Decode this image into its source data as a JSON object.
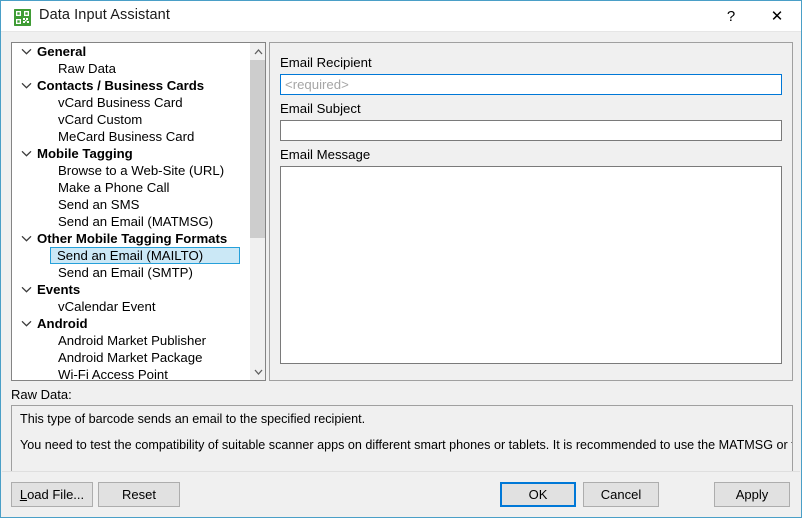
{
  "window": {
    "title": "Data Input Assistant",
    "icon": "qr-code-icon",
    "accent_color": "#4a9fc7",
    "help_label": "?",
    "close_label": "✕"
  },
  "tree": {
    "selected": "Send an Email (MAILTO)",
    "items": [
      {
        "label": "General",
        "type": "group",
        "expanded": true
      },
      {
        "label": "Raw Data",
        "type": "child"
      },
      {
        "label": "Contacts / Business Cards",
        "type": "group",
        "expanded": true
      },
      {
        "label": "vCard Business Card",
        "type": "child"
      },
      {
        "label": "vCard Custom",
        "type": "child"
      },
      {
        "label": "MeCard Business Card",
        "type": "child"
      },
      {
        "label": "Mobile Tagging",
        "type": "group",
        "expanded": true
      },
      {
        "label": "Browse to a Web-Site (URL)",
        "type": "child"
      },
      {
        "label": "Make a Phone Call",
        "type": "child"
      },
      {
        "label": "Send an SMS",
        "type": "child"
      },
      {
        "label": "Send an Email (MATMSG)",
        "type": "child"
      },
      {
        "label": "Other Mobile Tagging Formats",
        "type": "group",
        "expanded": true
      },
      {
        "label": "Send an Email (MAILTO)",
        "type": "child",
        "selected": true
      },
      {
        "label": "Send an Email (SMTP)",
        "type": "child"
      },
      {
        "label": "Events",
        "type": "group",
        "expanded": true
      },
      {
        "label": "vCalendar Event",
        "type": "child"
      },
      {
        "label": "Android",
        "type": "group",
        "expanded": true
      },
      {
        "label": "Android Market Publisher",
        "type": "child"
      },
      {
        "label": "Android Market Package",
        "type": "child"
      },
      {
        "label": "Wi-Fi Access Point",
        "type": "child"
      }
    ],
    "scrollbar": {
      "up_arrow": "chevron-up-icon",
      "down_arrow": "chevron-down-icon"
    }
  },
  "form": {
    "recipient": {
      "label": "Email Recipient",
      "value": "",
      "placeholder": "<required>",
      "focused": true
    },
    "subject": {
      "label": "Email Subject",
      "value": "",
      "placeholder": ""
    },
    "message": {
      "label": "Email Message",
      "value": "",
      "placeholder": ""
    }
  },
  "raw_data": {
    "label": "Raw Data:",
    "line1": "This type of barcode sends an email to the specified recipient.",
    "line2": "You need to test the compatibility of suitable scanner apps on different smart phones or tablets. It is recommended to use the MATMSG or the MAILTO format."
  },
  "buttons": {
    "load_file": "Load File...",
    "load_file_accel": "L",
    "load_file_rest": "oad File...",
    "reset": "Reset",
    "ok": "OK",
    "cancel": "Cancel",
    "apply": "Apply"
  }
}
